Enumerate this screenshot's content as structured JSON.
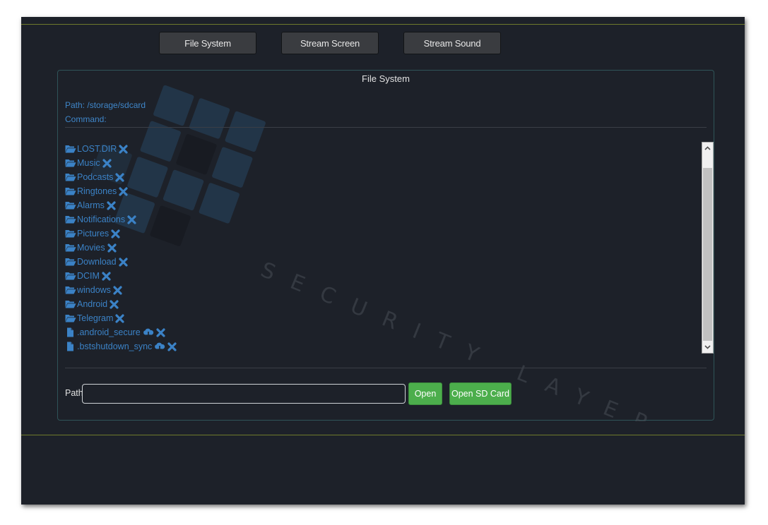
{
  "nav": {
    "file_system": "File System",
    "stream_screen": "Stream Screen",
    "stream_sound": "Stream Sound"
  },
  "panel": {
    "title": "File System",
    "path_line": "Path: /storage/sdcard",
    "command_line": "Command:"
  },
  "watermark_text": "SECURITY LAYER",
  "files": [
    {
      "name": "LOST.DIR",
      "type": "folder"
    },
    {
      "name": "Music",
      "type": "folder"
    },
    {
      "name": "Podcasts",
      "type": "folder"
    },
    {
      "name": "Ringtones",
      "type": "folder"
    },
    {
      "name": "Alarms",
      "type": "folder"
    },
    {
      "name": "Notifications",
      "type": "folder"
    },
    {
      "name": "Pictures",
      "type": "folder"
    },
    {
      "name": "Movies",
      "type": "folder"
    },
    {
      "name": "Download",
      "type": "folder"
    },
    {
      "name": "DCIM",
      "type": "folder"
    },
    {
      "name": "windows",
      "type": "folder"
    },
    {
      "name": "Android",
      "type": "folder"
    },
    {
      "name": "Telegram",
      "type": "folder"
    },
    {
      "name": ".android_secure",
      "type": "file"
    },
    {
      "name": ".bstshutdown_sync",
      "type": "file"
    }
  ],
  "icons": {
    "folder": "folder-open-icon",
    "file": "file-icon",
    "delete": "delete-x-icon",
    "download": "cloud-download-icon"
  },
  "path_form": {
    "label": "Path",
    "value": "",
    "open_label": "Open",
    "open_sd_label": "Open SD Card"
  },
  "colors": {
    "background": "#1d2129",
    "link_blue": "#3b82c6",
    "green_button": "#4cae4c",
    "accent_line": "#6e7a2c"
  }
}
